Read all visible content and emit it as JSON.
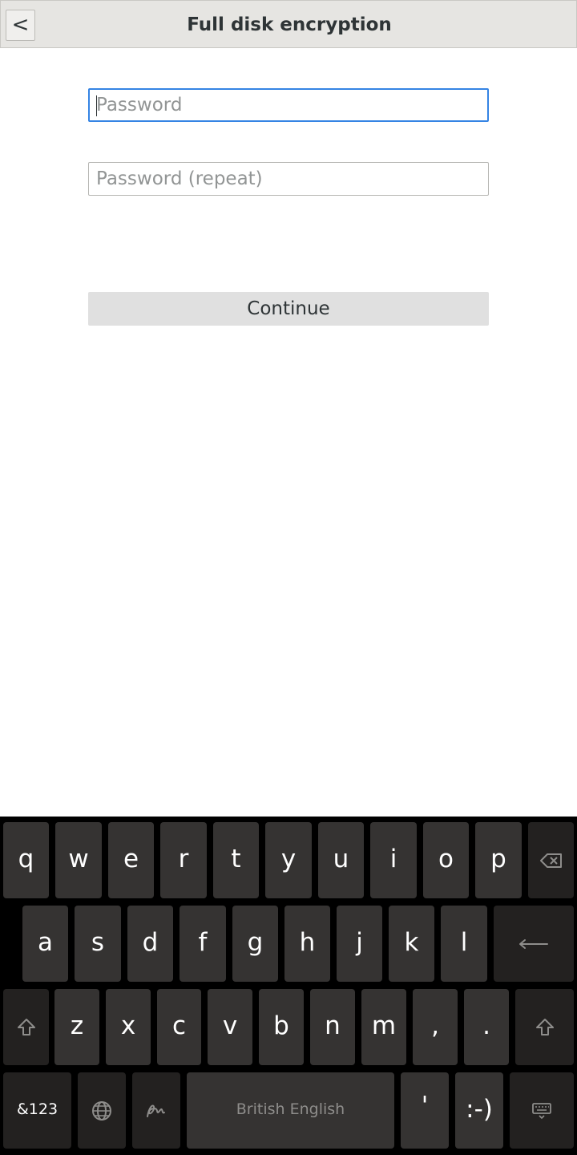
{
  "header": {
    "back_label": "<",
    "title": "Full disk encryption"
  },
  "form": {
    "password_placeholder": "Password",
    "password_value": "",
    "repeat_placeholder": "Password (repeat)",
    "repeat_value": "",
    "continue_label": "Continue"
  },
  "keyboard": {
    "row1": [
      "q",
      "w",
      "e",
      "r",
      "t",
      "y",
      "u",
      "i",
      "o",
      "p"
    ],
    "row2": [
      "a",
      "s",
      "d",
      "f",
      "g",
      "h",
      "j",
      "k",
      "l"
    ],
    "row3": [
      "z",
      "x",
      "c",
      "v",
      "b",
      "n",
      "m",
      ",",
      "."
    ],
    "symbols_label": "&123",
    "space_label": "British English",
    "apostrophe_label": "'",
    "smiley_label": ":-)",
    "icons": {
      "backspace": "backspace-icon",
      "enter": "enter-icon",
      "shift": "shift-icon",
      "globe": "globe-icon",
      "handwriting": "handwriting-icon",
      "hide": "keyboard-hide-icon"
    }
  }
}
